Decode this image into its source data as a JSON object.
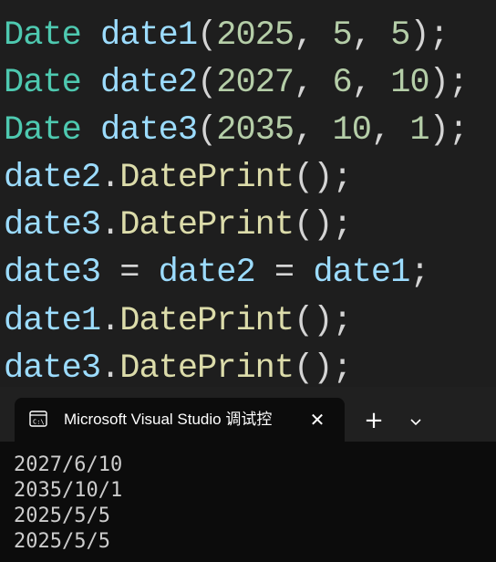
{
  "editor": {
    "lines": [
      [
        {
          "t": "type",
          "v": "Date"
        },
        {
          "t": "punc",
          "v": " "
        },
        {
          "t": "var",
          "v": "date1"
        },
        {
          "t": "punc",
          "v": "("
        },
        {
          "t": "num",
          "v": "2025"
        },
        {
          "t": "punc",
          "v": ", "
        },
        {
          "t": "num",
          "v": "5"
        },
        {
          "t": "punc",
          "v": ", "
        },
        {
          "t": "num",
          "v": "5"
        },
        {
          "t": "punc",
          "v": ");"
        }
      ],
      [
        {
          "t": "type",
          "v": "Date"
        },
        {
          "t": "punc",
          "v": " "
        },
        {
          "t": "var",
          "v": "date2"
        },
        {
          "t": "punc",
          "v": "("
        },
        {
          "t": "num",
          "v": "2027"
        },
        {
          "t": "punc",
          "v": ", "
        },
        {
          "t": "num",
          "v": "6"
        },
        {
          "t": "punc",
          "v": ", "
        },
        {
          "t": "num",
          "v": "10"
        },
        {
          "t": "punc",
          "v": ");"
        }
      ],
      [
        {
          "t": "type",
          "v": "Date"
        },
        {
          "t": "punc",
          "v": " "
        },
        {
          "t": "var",
          "v": "date3"
        },
        {
          "t": "punc",
          "v": "("
        },
        {
          "t": "num",
          "v": "2035"
        },
        {
          "t": "punc",
          "v": ", "
        },
        {
          "t": "num",
          "v": "10"
        },
        {
          "t": "punc",
          "v": ", "
        },
        {
          "t": "num",
          "v": "1"
        },
        {
          "t": "punc",
          "v": ");"
        }
      ],
      [
        {
          "t": "var",
          "v": "date2"
        },
        {
          "t": "punc",
          "v": "."
        },
        {
          "t": "fn",
          "v": "DatePrint"
        },
        {
          "t": "punc",
          "v": "();"
        }
      ],
      [
        {
          "t": "var",
          "v": "date3"
        },
        {
          "t": "punc",
          "v": "."
        },
        {
          "t": "fn",
          "v": "DatePrint"
        },
        {
          "t": "punc",
          "v": "();"
        }
      ],
      [
        {
          "t": "var",
          "v": "date3"
        },
        {
          "t": "punc",
          "v": " = "
        },
        {
          "t": "var",
          "v": "date2"
        },
        {
          "t": "punc",
          "v": " = "
        },
        {
          "t": "var",
          "v": "date1"
        },
        {
          "t": "punc",
          "v": ";"
        }
      ],
      [
        {
          "t": "var",
          "v": "date1"
        },
        {
          "t": "punc",
          "v": "."
        },
        {
          "t": "fn",
          "v": "DatePrint"
        },
        {
          "t": "punc",
          "v": "();"
        }
      ],
      [
        {
          "t": "var",
          "v": "date3"
        },
        {
          "t": "punc",
          "v": "."
        },
        {
          "t": "fn",
          "v": "DatePrint"
        },
        {
          "t": "punc",
          "v": "();"
        }
      ]
    ]
  },
  "terminal": {
    "tab_title": "Microsoft Visual Studio 调试控",
    "close_glyph": "✕",
    "new_tab_glyph": "+",
    "dropdown_glyph": "⌄",
    "output": [
      "2027/6/10",
      "2035/10/1",
      "2025/5/5",
      "2025/5/5"
    ]
  }
}
